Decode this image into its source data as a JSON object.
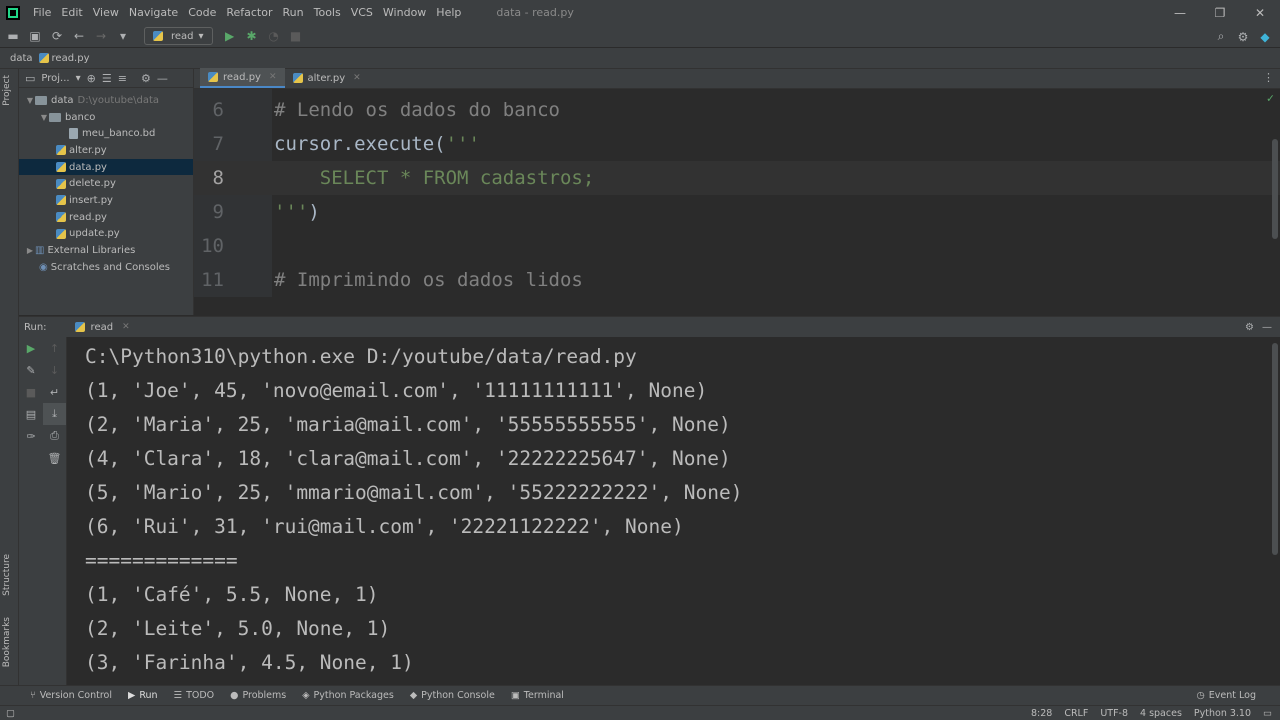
{
  "menu": [
    "File",
    "Edit",
    "View",
    "Navigate",
    "Code",
    "Refactor",
    "Run",
    "Tools",
    "VCS",
    "Window",
    "Help"
  ],
  "window_title": "data - read.py",
  "toolbar": {
    "run_config": "read"
  },
  "breadcrumb": {
    "project": "data",
    "file": "read.py"
  },
  "left_strip": {
    "project_label": "Project",
    "structure_label": "Structure",
    "bookmarks_label": "Bookmarks"
  },
  "project_panel": {
    "header": "Proj...",
    "root": {
      "name": "data",
      "path": "D:\\youtube\\data"
    },
    "folder": "banco",
    "db_file": "meu_banco.bd",
    "files": [
      "alter.py",
      "data.py",
      "delete.py",
      "insert.py",
      "read.py",
      "update.py"
    ],
    "external": "External Libraries",
    "scratches": "Scratches and Consoles"
  },
  "editor_tabs": [
    "read.py",
    "alter.py"
  ],
  "editor": {
    "current_line": 8,
    "lines": [
      {
        "num": "6",
        "text": "# Lendo os dados do banco"
      },
      {
        "num": "7",
        "code": "cursor.execute(",
        "str": "'''"
      },
      {
        "num": "8",
        "str": "    SELECT * FROM cadastros;"
      },
      {
        "num": "9",
        "str": "'''",
        "code": ")"
      },
      {
        "num": "10",
        "text": ""
      },
      {
        "num": "11",
        "text": "# Imprimindo os dados lidos"
      }
    ]
  },
  "run_panel": {
    "label": "Run:",
    "tab": "read",
    "output": [
      "C:\\Python310\\python.exe D:/youtube/data/read.py",
      "(1, 'Joe', 45, 'novo@email.com', '11111111111', None)",
      "(2, 'Maria', 25, 'maria@mail.com', '55555555555', None)",
      "(4, 'Clara', 18, 'clara@mail.com', '22222225647', None)",
      "(5, 'Mario', 25, 'mmario@mail.com', '55222222222', None)",
      "(6, 'Rui', 31, 'rui@mail.com', '22221122222', None)",
      "=============",
      "(1, 'Café', 5.5, None, 1)",
      "(2, 'Leite', 5.0, None, 1)",
      "(3, 'Farinha', 4.5, None, 1)"
    ]
  },
  "bottom_tabs": [
    "Version Control",
    "Run",
    "TODO",
    "Problems",
    "Python Packages",
    "Python Console",
    "Terminal"
  ],
  "event_log": "Event Log",
  "status": {
    "position": "8:28",
    "line_sep": "CRLF",
    "encoding": "UTF-8",
    "indent": "4 spaces",
    "interpreter": "Python 3.10"
  }
}
